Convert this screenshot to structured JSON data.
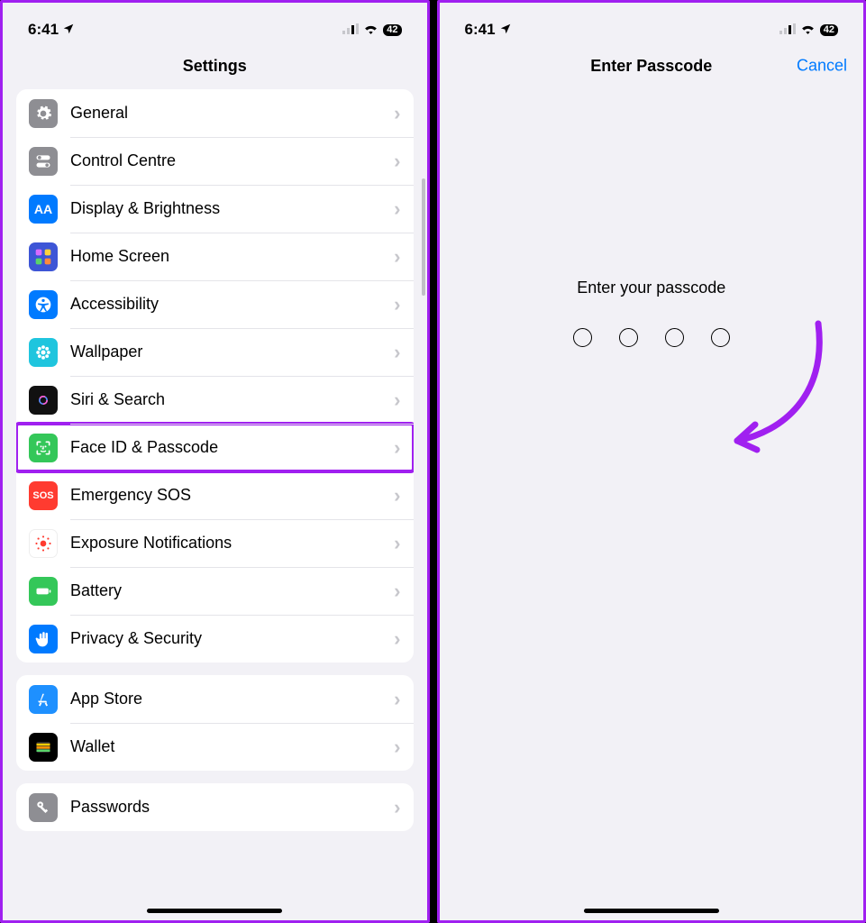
{
  "status": {
    "time": "6:41",
    "battery": "42"
  },
  "left": {
    "title": "Settings",
    "groups": [
      {
        "items": [
          {
            "id": "general",
            "label": "General",
            "icon": "gear",
            "bg": "#8e8e93"
          },
          {
            "id": "control-centre",
            "label": "Control Centre",
            "icon": "switches",
            "bg": "#8e8e93"
          },
          {
            "id": "display",
            "label": "Display & Brightness",
            "icon": "aa",
            "bg": "#007aff"
          },
          {
            "id": "home-screen",
            "label": "Home Screen",
            "icon": "grid",
            "bg": "#3d55d6"
          },
          {
            "id": "accessibility",
            "label": "Accessibility",
            "icon": "access",
            "bg": "#007aff"
          },
          {
            "id": "wallpaper",
            "label": "Wallpaper",
            "icon": "flower",
            "bg": "#1fc5de"
          },
          {
            "id": "siri",
            "label": "Siri & Search",
            "icon": "siri",
            "bg": "#111111"
          },
          {
            "id": "faceid",
            "label": "Face ID & Passcode",
            "icon": "faceid",
            "bg": "#34c759",
            "highlight": true
          },
          {
            "id": "sos",
            "label": "Emergency SOS",
            "icon": "sos",
            "bg": "#ff3b30"
          },
          {
            "id": "exposure",
            "label": "Exposure Notifications",
            "icon": "exposure",
            "bg": "#ffffff"
          },
          {
            "id": "battery",
            "label": "Battery",
            "icon": "battery",
            "bg": "#34c759"
          },
          {
            "id": "privacy",
            "label": "Privacy & Security",
            "icon": "hand",
            "bg": "#007aff"
          }
        ]
      },
      {
        "items": [
          {
            "id": "appstore",
            "label": "App Store",
            "icon": "appstore",
            "bg": "#1e90ff"
          },
          {
            "id": "wallet",
            "label": "Wallet",
            "icon": "wallet",
            "bg": "#000000"
          }
        ]
      },
      {
        "items": [
          {
            "id": "passwords",
            "label": "Passwords",
            "icon": "key",
            "bg": "#8e8e93"
          }
        ]
      }
    ]
  },
  "right": {
    "title": "Enter Passcode",
    "cancel": "Cancel",
    "prompt": "Enter your passcode",
    "dot_count": 4
  },
  "colors": {
    "highlight_border": "#a020f0",
    "link": "#007aff"
  }
}
